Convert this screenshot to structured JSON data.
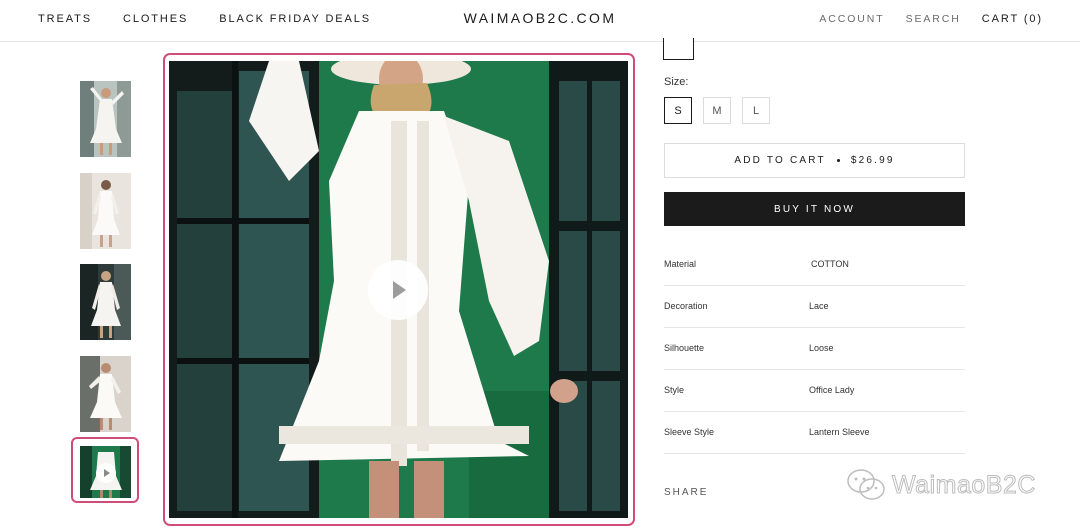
{
  "header": {
    "nav_left": [
      "TREATS",
      "CLOTHES",
      "BLACK FRIDAY DEALS"
    ],
    "logo": "WAIMAOB2C.COM",
    "account": "ACCOUNT",
    "search": "SEARCH",
    "cart": "CART (0)"
  },
  "gallery": {
    "thumbnails": 5,
    "active_thumbnail": 5,
    "active_thumbnail_is_video": true,
    "main_shows_play_button": true
  },
  "product": {
    "size_label": "Size:",
    "sizes": [
      "S",
      "M",
      "L"
    ],
    "selected_size": "S",
    "add_to_cart_label": "ADD TO CART",
    "price": "$26.99",
    "buy_now_label": "BUY IT NOW",
    "specs": [
      {
        "key": "Material",
        "value": "COTTON"
      },
      {
        "key": "Decoration",
        "value": "Lace"
      },
      {
        "key": "Silhouette",
        "value": "Loose"
      },
      {
        "key": "Style",
        "value": "Office Lady"
      },
      {
        "key": "Sleeve Style",
        "value": "Lantern Sleeve"
      }
    ],
    "share_label": "SHARE"
  },
  "watermark": {
    "text": "WaimaoB2C"
  },
  "colors": {
    "highlight": "#d04d7a",
    "primary": "#1c1b1b",
    "backdrop_green": "#1e7a4a"
  }
}
